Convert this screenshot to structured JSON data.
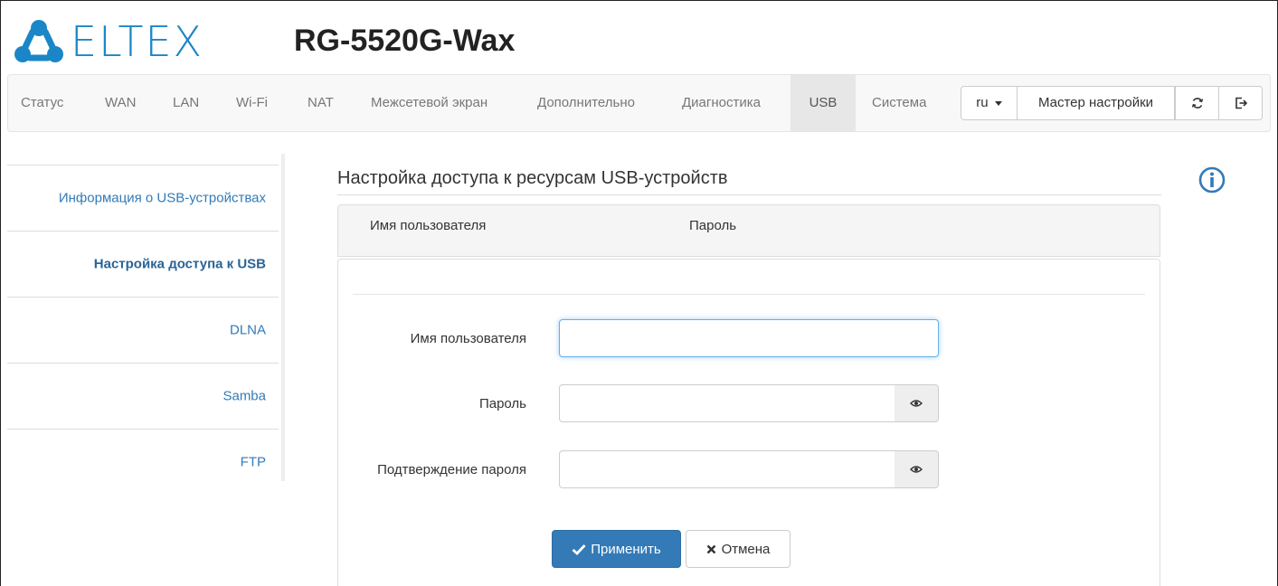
{
  "header": {
    "logo_text": "ELTEX",
    "model": "RG-5520G-Wax",
    "brand_color": "#1b86c7"
  },
  "navbar": {
    "items": [
      {
        "label": "Статус"
      },
      {
        "label": "WAN"
      },
      {
        "label": "LAN"
      },
      {
        "label": "Wi-Fi"
      },
      {
        "label": "NAT"
      },
      {
        "label": "Межсетевой экран"
      },
      {
        "label": "Дополнительно"
      },
      {
        "label": "Диагностика"
      },
      {
        "label": "USB",
        "active": true
      },
      {
        "label": "Система"
      }
    ],
    "language": "ru",
    "wizard_label": "Мастер настройки",
    "refresh_icon": "refresh-icon",
    "logout_icon": "logout-icon"
  },
  "sidebar": {
    "items": [
      {
        "label": "Информация о USB-устройствах"
      },
      {
        "label": "Настройка доступа к USB",
        "active": true
      },
      {
        "label": "DLNA"
      },
      {
        "label": "Samba"
      },
      {
        "label": "FTP"
      }
    ]
  },
  "content": {
    "title": "Настройка доступа к ресурсам USB-устройств",
    "table": {
      "headers": [
        "Имя пользователя",
        "Пароль"
      ]
    },
    "form": {
      "username_label": "Имя пользователя",
      "username_value": "",
      "password_label": "Пароль",
      "password_value": "",
      "confirm_label": "Подтверждение пароля",
      "confirm_value": ""
    },
    "apply_label": "Применить",
    "cancel_label": "Отмена",
    "accent_color": "#337ab7"
  }
}
